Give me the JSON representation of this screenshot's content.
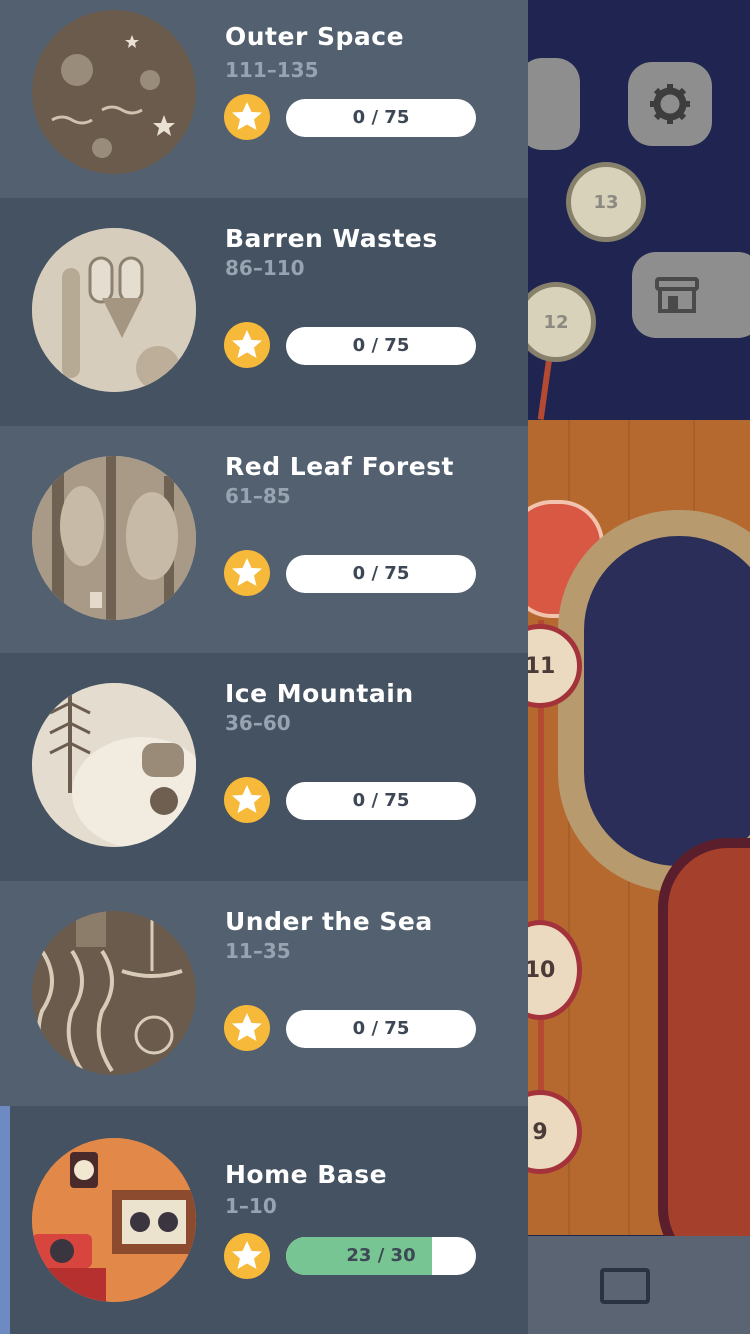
{
  "worlds": [
    {
      "name": "Outer Space",
      "range": "111–135",
      "stars": "0 / 75",
      "progress": 0,
      "thumb_icon": "planets-icon"
    },
    {
      "name": "Barren Wastes",
      "range": "86–110",
      "stars": "0 / 75",
      "progress": 0,
      "thumb_icon": "desert-fox-icon"
    },
    {
      "name": "Red Leaf Forest",
      "range": "61–85",
      "stars": "0 / 75",
      "progress": 0,
      "thumb_icon": "forest-icon"
    },
    {
      "name": "Ice Mountain",
      "range": "36–60",
      "stars": "0 / 75",
      "progress": 0,
      "thumb_icon": "yeti-icon"
    },
    {
      "name": "Under the Sea",
      "range": "11–35",
      "stars": "0 / 75",
      "progress": 0,
      "thumb_icon": "octopus-icon"
    },
    {
      "name": "Home Base",
      "range": "1–10",
      "stars": "23 / 30",
      "progress": 0.767,
      "thumb_icon": "home-room-icon",
      "selected": true
    }
  ],
  "map": {
    "nodes": [
      {
        "label": "13"
      },
      {
        "label": "12"
      },
      {
        "label": "11"
      },
      {
        "label": "10"
      },
      {
        "label": "9"
      }
    ],
    "settings_icon": "gear-icon",
    "shop_icon": "shop-icon",
    "news_icon": "news-icon"
  },
  "colors": {
    "accent_star": "#f6b93a",
    "progress_fill": "#77c592",
    "selected_marker": "#6e8ac2"
  }
}
